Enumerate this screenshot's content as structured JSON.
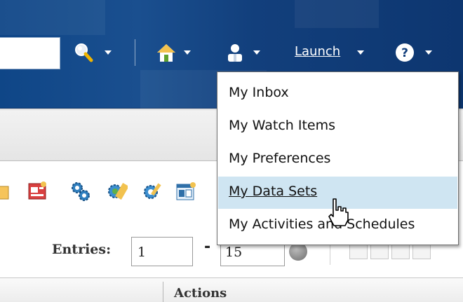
{
  "header": {
    "search_value": "",
    "launch_label": "Launch",
    "icons": [
      "search-icon",
      "home-icon",
      "user-icon",
      "help-icon"
    ]
  },
  "user_menu": {
    "items": [
      {
        "label": "My Inbox"
      },
      {
        "label": "My Watch Items"
      },
      {
        "label": "My Preferences"
      },
      {
        "label": "My Data Sets",
        "highlighted": true
      },
      {
        "label": "My Activities and Schedules"
      }
    ]
  },
  "toolbar": {
    "icons": [
      "new-item-icon",
      "report-icon",
      "gears-icon",
      "gear-globe-icon",
      "gear-edit-icon",
      "form-add-icon"
    ]
  },
  "pagination": {
    "entries_label": "Entries:",
    "from_value": "1",
    "separator": "-",
    "to_value": "15"
  },
  "table": {
    "columns": [
      "",
      "Actions"
    ]
  },
  "colors": {
    "banner": "#123f7c",
    "menu_highlight": "#cfe5f2",
    "menu_border": "#6f6f6f"
  }
}
